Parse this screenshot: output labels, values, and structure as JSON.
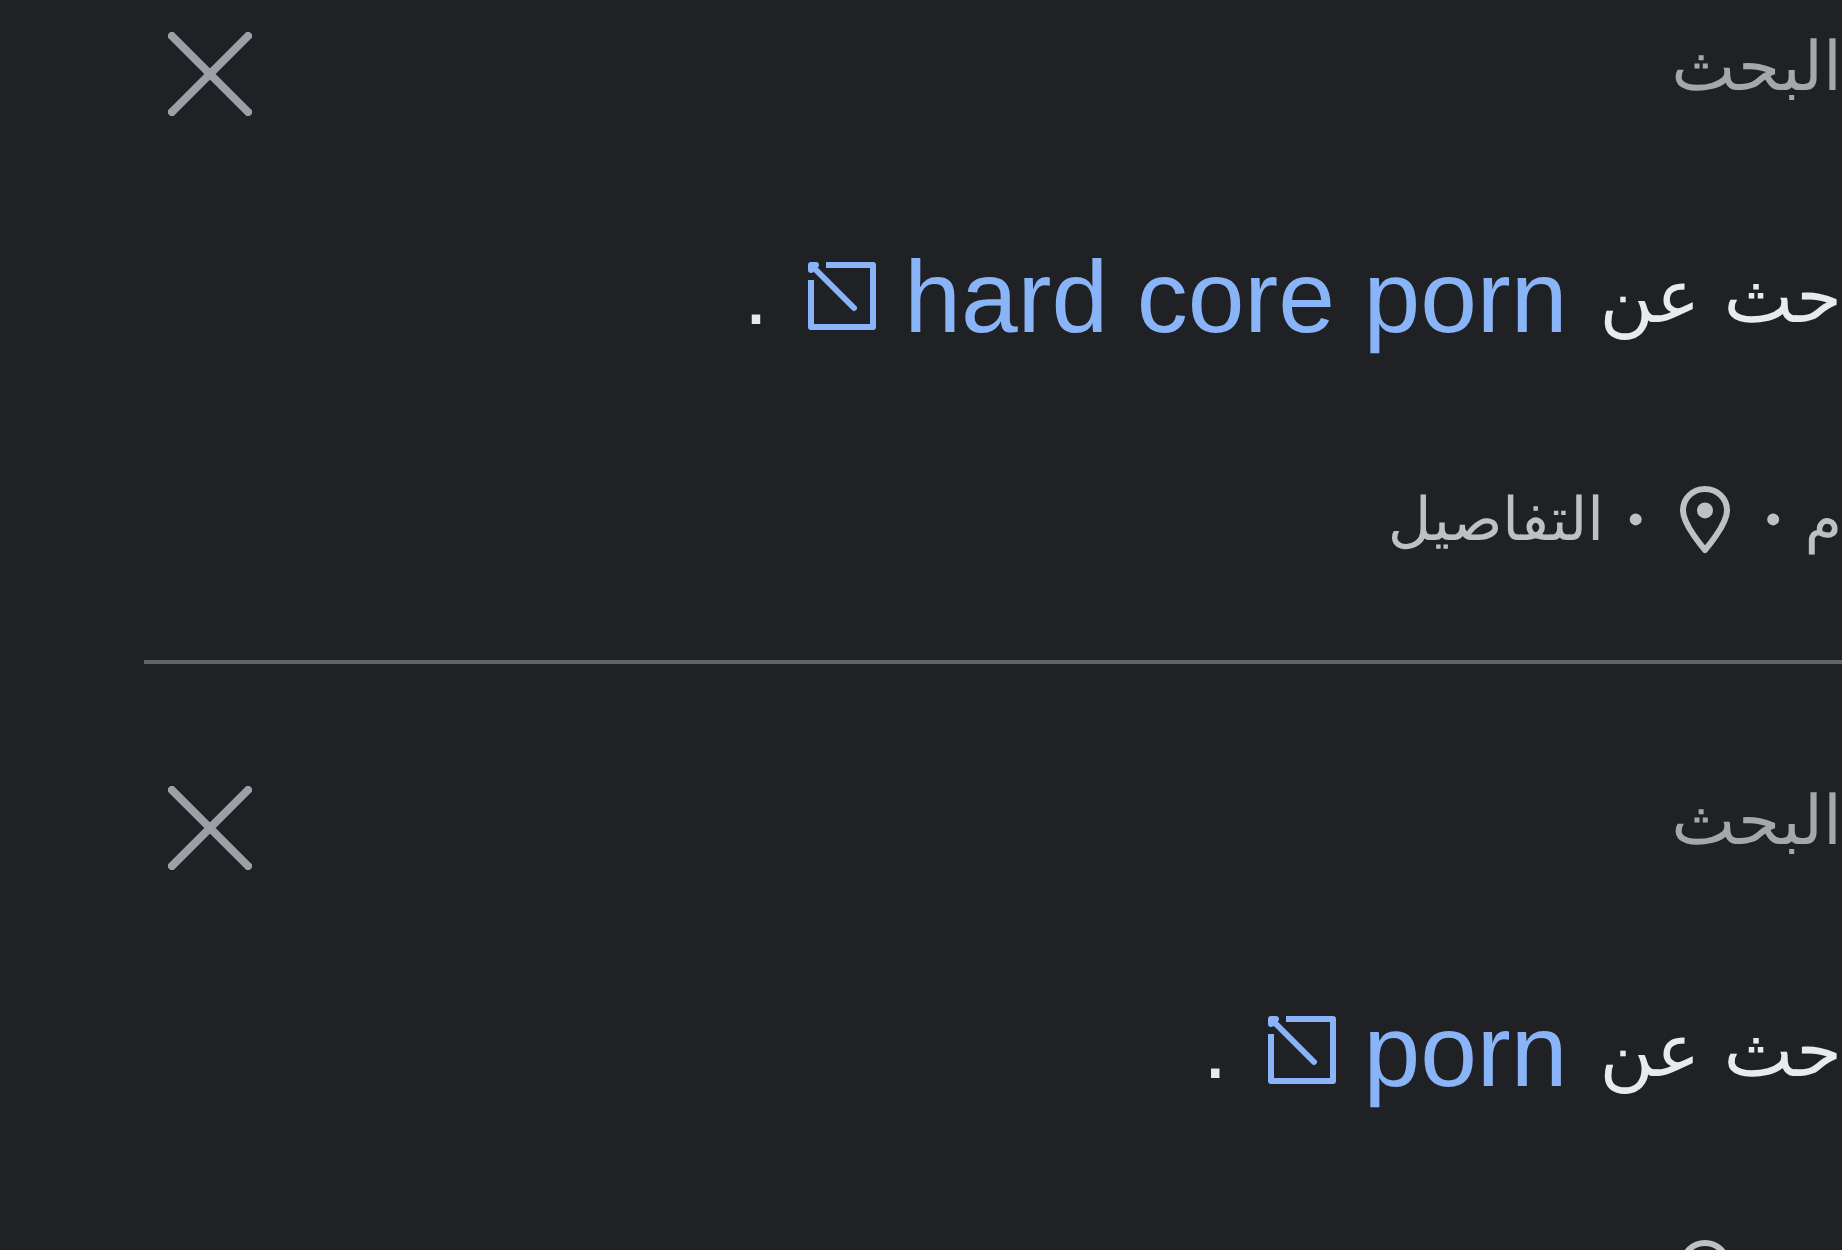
{
  "activity_items": [
    {
      "heading": "البحث",
      "query_line": {
        "prefix": "حث عن",
        "link": "hard core porn",
        "suffix": "."
      },
      "meta": [
        {
          "kind": "text",
          "text": "م"
        },
        {
          "kind": "separator",
          "text": "•"
        },
        {
          "kind": "icon"
        },
        {
          "kind": "separator",
          "text": "•"
        },
        {
          "kind": "link",
          "text": "التفاصيل"
        }
      ]
    },
    {
      "heading": "البحث",
      "query_line": {
        "prefix": "حث عن",
        "link": "porn",
        "suffix": "."
      },
      "meta": [
        {
          "kind": "icon"
        }
      ]
    }
  ]
}
